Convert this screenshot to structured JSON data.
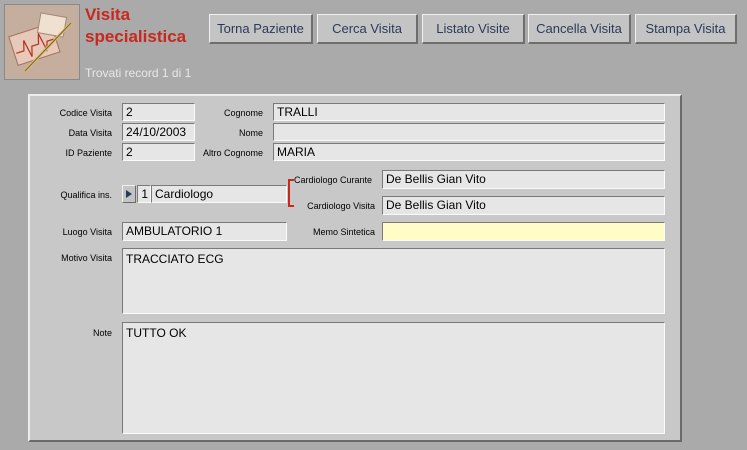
{
  "header": {
    "title": "Visita specialistica",
    "record_status": "Trovati record 1 di 1"
  },
  "toolbar": {
    "torna_paziente": "Torna Paziente",
    "cerca_visita": "Cerca Visita",
    "listato_visite": "Listato Visite",
    "cancella_visita": "Cancella Visita",
    "stampa_visita": "Stampa Visita"
  },
  "labels": {
    "codice_visita": "Codice Visita",
    "data_visita": "Data Visita",
    "id_paziente": "ID Paziente",
    "cognome": "Cognome",
    "nome": "Nome",
    "altro_cognome": "Altro Cognome",
    "qualifica_ins": "Qualifica ins.",
    "cardiologo_curante": "Cardiologo Curante",
    "cardiologo_visita": "Cardiologo Visita",
    "luogo_visita": "Luogo Visita",
    "memo_sintetica": "Memo Sintetica",
    "motivo_visita": "Motivo Visita",
    "note": "Note"
  },
  "values": {
    "codice_visita": "2",
    "data_visita": "24/10/2003",
    "id_paziente": "2",
    "cognome": "TRALLI",
    "nome": "",
    "altro_cognome": "MARIA",
    "qualifica_code": "1",
    "qualifica_desc": "Cardiologo",
    "cardiologo_curante": "De Bellis  Gian Vito",
    "cardiologo_visita": "De Bellis  Gian Vito",
    "luogo_visita": "AMBULATORIO 1",
    "memo_sintetica": "",
    "motivo_visita": "TRACCIATO ECG",
    "note": "TUTTO OK"
  },
  "colors": {
    "title": "#c8281e",
    "memo_field": "#fffcc8"
  }
}
